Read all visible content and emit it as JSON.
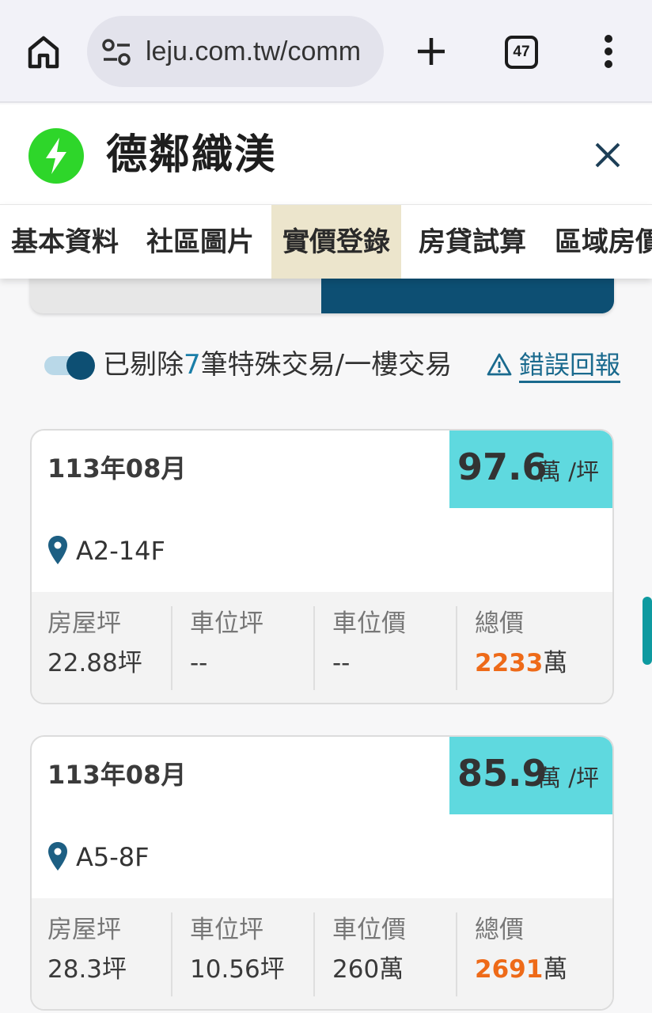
{
  "browser": {
    "url": "leju.com.tw/comm",
    "tab_count": "47"
  },
  "app": {
    "title": "德鄰織渼"
  },
  "tabs": [
    {
      "label": "基本資料",
      "active": false
    },
    {
      "label": "社區圖片",
      "active": false
    },
    {
      "label": "實價登錄",
      "active": true
    },
    {
      "label": "房貸試算",
      "active": false
    },
    {
      "label": "區域房價",
      "active": false
    }
  ],
  "filter": {
    "prefix": "已剔除",
    "count": "7",
    "suffix": "筆特殊交易/一樓交易",
    "report_label": "錯誤回報"
  },
  "records": [
    {
      "date": "113年08月",
      "unit_price": "97.6",
      "unit_price_unit": "萬 /坪",
      "unit": "A2-14F",
      "stats": {
        "house_area_label": "房屋坪",
        "house_area": "22.88坪",
        "parking_area_label": "車位坪",
        "parking_area": "--",
        "parking_price_label": "車位價",
        "parking_price": "--",
        "total_label": "總價",
        "total": "2233",
        "total_unit": "萬"
      }
    },
    {
      "date": "113年08月",
      "unit_price": "85.9",
      "unit_price_unit": "萬 /坪",
      "unit": "A5-8F",
      "stats": {
        "house_area_label": "房屋坪",
        "house_area": "28.3坪",
        "parking_area_label": "車位坪",
        "parking_area": "10.56坪",
        "parking_price_label": "車位價",
        "parking_price": "260萬",
        "total_label": "總價",
        "total": "2691",
        "total_unit": "萬"
      }
    }
  ],
  "colors": {
    "accent_dark": "#0d4f73",
    "price_box": "#5fd9df",
    "total_highlight": "#ee6a18",
    "active_tab": "#ece5cc",
    "app_icon": "#2ed62a"
  }
}
